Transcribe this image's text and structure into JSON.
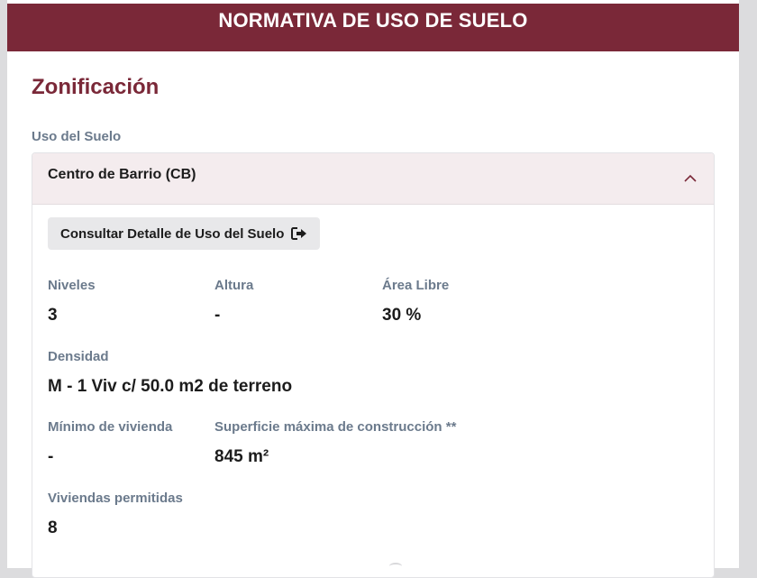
{
  "header": {
    "title": "NORMATIVA DE USO DE SUELO"
  },
  "section": {
    "title": "Zonificación",
    "uso_label": "Uso del Suelo"
  },
  "accordion": {
    "title": "Centro de Barrio (CB)",
    "expanded": true,
    "detail_button_label": "Consultar Detalle de Uso del Suelo",
    "detail_button_icon": "external-link-icon"
  },
  "fields": {
    "niveles": {
      "label": "Niveles",
      "value": "3"
    },
    "altura": {
      "label": "Altura",
      "value": "-"
    },
    "area_libre": {
      "label": "Área Libre",
      "value": "30 %"
    },
    "densidad": {
      "label": "Densidad",
      "value": "M - 1 Viv c/ 50.0 m2 de terreno"
    },
    "minimo_vivienda": {
      "label": "Mínimo de vivienda",
      "value": "-"
    },
    "superficie_maxima": {
      "label": "Superficie máxima de construcción **",
      "value": "845 m²"
    },
    "viviendas_permitidas": {
      "label": "Viviendas permitidas",
      "value": "8"
    }
  },
  "colors": {
    "brand": "#7a2838",
    "label": "#6b7a8c",
    "accordion_header_bg": "#f4ecee",
    "button_bg": "#e8e8ea"
  }
}
